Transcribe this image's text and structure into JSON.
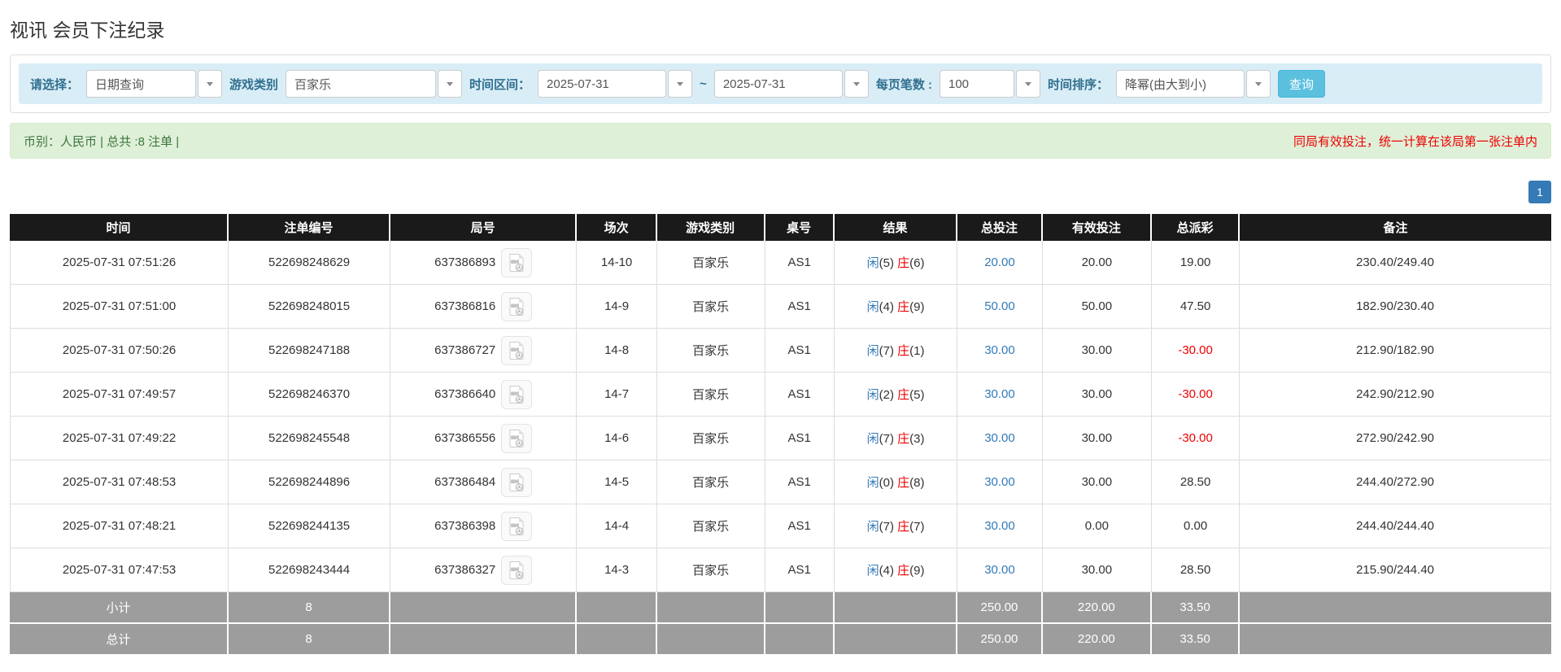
{
  "title": "视讯 会员下注纪录",
  "filters": {
    "select_label": "请选择：",
    "select_value": "日期查询",
    "game_label": "游戏类别",
    "game_value": "百家乐",
    "range_label": "时间区间：",
    "date_from": "2025-07-31",
    "range_separator": "~",
    "date_to": "2025-07-31",
    "page_size_label": "每页笔数 :",
    "page_size_value": "100",
    "sort_label": "时间排序：",
    "sort_value": "降幂(由大到小)",
    "search_label": "查询"
  },
  "summary": {
    "info": "币别：人民币 | 总共 :8 注单 |",
    "notice": "同局有效投注，统一计算在该局第一张注单内"
  },
  "pagination": {
    "page": "1"
  },
  "table": {
    "headers": [
      "时间",
      "注单编号",
      "局号",
      "场次",
      "游戏类别",
      "桌号",
      "结果",
      "总投注",
      "有效投注",
      "总派彩",
      "备注"
    ],
    "rows": [
      {
        "time": "2025-07-31 07:51:26",
        "bet_id": "522698248629",
        "round_id": "637386893",
        "session": "14-10",
        "game": "百家乐",
        "table_no": "AS1",
        "player": "闲",
        "player_score": "(5)",
        "banker": "庄",
        "banker_score": "(6)",
        "total_bet": "20.00",
        "valid_bet": "20.00",
        "payout": "19.00",
        "remark": "230.40/249.40"
      },
      {
        "time": "2025-07-31 07:51:00",
        "bet_id": "522698248015",
        "round_id": "637386816",
        "session": "14-9",
        "game": "百家乐",
        "table_no": "AS1",
        "player": "闲",
        "player_score": "(4)",
        "banker": "庄",
        "banker_score": "(9)",
        "total_bet": "50.00",
        "valid_bet": "50.00",
        "payout": "47.50",
        "remark": "182.90/230.40"
      },
      {
        "time": "2025-07-31 07:50:26",
        "bet_id": "522698247188",
        "round_id": "637386727",
        "session": "14-8",
        "game": "百家乐",
        "table_no": "AS1",
        "player": "闲",
        "player_score": "(7)",
        "banker": "庄",
        "banker_score": "(1)",
        "total_bet": "30.00",
        "valid_bet": "30.00",
        "payout": "-30.00",
        "remark": "212.90/182.90"
      },
      {
        "time": "2025-07-31 07:49:57",
        "bet_id": "522698246370",
        "round_id": "637386640",
        "session": "14-7",
        "game": "百家乐",
        "table_no": "AS1",
        "player": "闲",
        "player_score": "(2)",
        "banker": "庄",
        "banker_score": "(5)",
        "total_bet": "30.00",
        "valid_bet": "30.00",
        "payout": "-30.00",
        "remark": "242.90/212.90"
      },
      {
        "time": "2025-07-31 07:49:22",
        "bet_id": "522698245548",
        "round_id": "637386556",
        "session": "14-6",
        "game": "百家乐",
        "table_no": "AS1",
        "player": "闲",
        "player_score": "(7)",
        "banker": "庄",
        "banker_score": "(3)",
        "total_bet": "30.00",
        "valid_bet": "30.00",
        "payout": "-30.00",
        "remark": "272.90/242.90"
      },
      {
        "time": "2025-07-31 07:48:53",
        "bet_id": "522698244896",
        "round_id": "637386484",
        "session": "14-5",
        "game": "百家乐",
        "table_no": "AS1",
        "player": "闲",
        "player_score": "(0)",
        "banker": "庄",
        "banker_score": "(8)",
        "total_bet": "30.00",
        "valid_bet": "30.00",
        "payout": "28.50",
        "remark": "244.40/272.90"
      },
      {
        "time": "2025-07-31 07:48:21",
        "bet_id": "522698244135",
        "round_id": "637386398",
        "session": "14-4",
        "game": "百家乐",
        "table_no": "AS1",
        "player": "闲",
        "player_score": "(7)",
        "banker": "庄",
        "banker_score": "(7)",
        "total_bet": "30.00",
        "valid_bet": "0.00",
        "payout": "0.00",
        "remark": "244.40/244.40"
      },
      {
        "time": "2025-07-31 07:47:53",
        "bet_id": "522698243444",
        "round_id": "637386327",
        "session": "14-3",
        "game": "百家乐",
        "table_no": "AS1",
        "player": "闲",
        "player_score": "(4)",
        "banker": "庄",
        "banker_score": "(9)",
        "total_bet": "30.00",
        "valid_bet": "30.00",
        "payout": "28.50",
        "remark": "215.90/244.40"
      }
    ],
    "subtotal": {
      "label": "小计",
      "count": "8",
      "total_bet": "250.00",
      "valid_bet": "220.00",
      "payout": "33.50"
    },
    "grand_total": {
      "label": "总计",
      "count": "8",
      "total_bet": "250.00",
      "valid_bet": "220.00",
      "payout": "33.50"
    }
  },
  "icons": {
    "caret": "caret-down-icon",
    "video": "video-replay-icon"
  },
  "colors": {
    "accent_blue": "#337ab7",
    "banker_red": "#ee0000",
    "notice_red": "#ee0000",
    "filter_bg": "#d9edf7",
    "filter_label_text": "#31708f",
    "search_button_bg": "#5bc0de",
    "search_button_border": "#46b8da",
    "summary_bg": "#dff0d8",
    "summary_text": "#3c763d",
    "table_header_bg": "#1a1a1a",
    "table_footer_bg": "#9d9d9d"
  }
}
